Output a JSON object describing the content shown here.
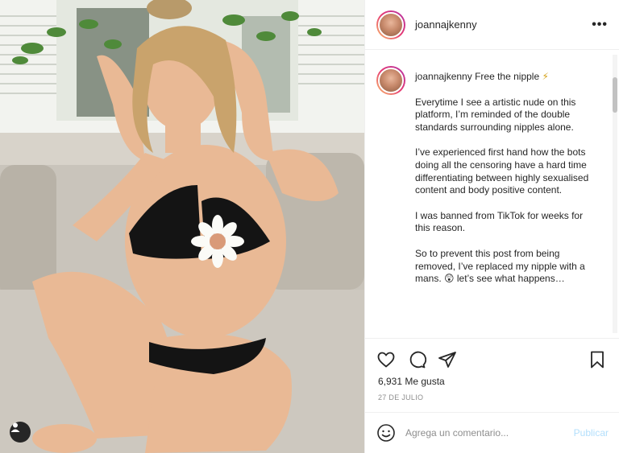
{
  "post": {
    "username": "joannajkenny",
    "caption_title": "Free the nipple",
    "caption_emoji": "⚡",
    "caption_paragraphs": [
      "Everytime I see a artistic nude on this platform, I’m reminded of the double standards surrounding nipples alone.",
      "I’ve experienced first hand how the bots doing all the censoring have a hard time differentiating between highly sexualised content and body positive content.",
      "I was banned from TikTok for weeks for this reason.",
      "So to prevent this post from being removed, I’ve replaced my nipple with a mans. 😲 let’s see what happens…"
    ],
    "likes": "6,931 Me gusta",
    "date": "27 DE JULIO"
  },
  "comment": {
    "placeholder": "Agrega un comentario...",
    "publish_label": "Publicar"
  },
  "icons": {
    "more": "•••",
    "like": "heart-icon",
    "comment": "comment-icon",
    "share": "share-icon",
    "save": "bookmark-icon",
    "emoji": "emoji-icon",
    "user_tag": "user-tag-icon"
  },
  "colors": {
    "text": "#262626",
    "muted": "#8e8e8e",
    "publish_disabled": "#b2dffc",
    "border": "#efefef"
  }
}
